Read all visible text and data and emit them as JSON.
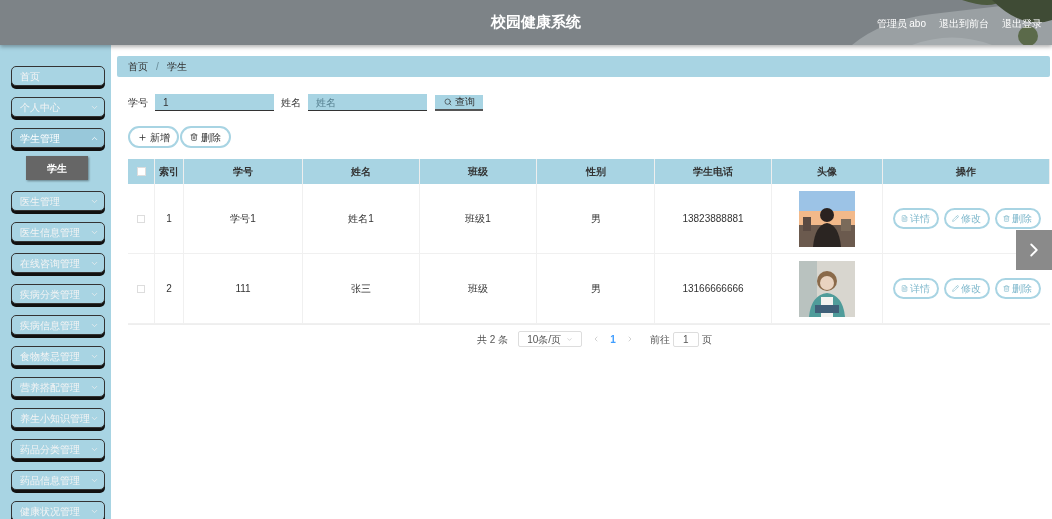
{
  "header": {
    "title": "校园健康系统",
    "links": [
      "管理员 abo",
      "退出到前台",
      "退出登录"
    ]
  },
  "sidebar": {
    "items": [
      {
        "label": "首页"
      },
      {
        "label": "个人中心",
        "expanded": false
      },
      {
        "label": "学生管理",
        "expanded": true,
        "children": [
          {
            "label": "学生",
            "selected": true
          }
        ]
      },
      {
        "label": "医生管理",
        "expanded": false
      },
      {
        "label": "医生信息管理",
        "expanded": false
      },
      {
        "label": "在线咨询管理",
        "expanded": false
      },
      {
        "label": "疾病分类管理",
        "expanded": false
      },
      {
        "label": "疾病信息管理",
        "expanded": false
      },
      {
        "label": "食物禁忌管理",
        "expanded": false
      },
      {
        "label": "营养搭配管理",
        "expanded": false
      },
      {
        "label": "养生小知识管理",
        "expanded": false
      },
      {
        "label": "药品分类管理",
        "expanded": false
      },
      {
        "label": "药品信息管理",
        "expanded": false
      },
      {
        "label": "健康状况管理",
        "expanded": false
      }
    ]
  },
  "breadcrumb": [
    "首页",
    "学生"
  ],
  "breadcrumb_separator": "/",
  "search": {
    "fields": [
      {
        "label": "学号",
        "value": "1"
      },
      {
        "label": "姓名",
        "placeholder": "姓名"
      }
    ],
    "button": "查询"
  },
  "actions": [
    {
      "kind": "add",
      "label": "新增"
    },
    {
      "kind": "delete",
      "label": "删除"
    }
  ],
  "table": {
    "all_checked": false,
    "columns": [
      "索引",
      "学号",
      "姓名",
      "班级",
      "性别",
      "学生电话",
      "头像",
      "操作"
    ],
    "rows": [
      {
        "checked": false,
        "index": "1",
        "student_no": "学号1",
        "name": "姓名1",
        "class": "班级1",
        "gender": "男",
        "phone": "13823888881",
        "buttons": [
          "详情",
          "修改",
          "删除"
        ]
      },
      {
        "checked": false,
        "index": "2",
        "student_no": "111",
        "name": "张三",
        "class": "班级",
        "gender": "男",
        "phone": "13166666666",
        "buttons": [
          "详情",
          "修改",
          "删除"
        ]
      }
    ]
  },
  "pagination": {
    "total": "共 2 条",
    "page_size": "10条/页",
    "pages": [
      {
        "label": "1",
        "selected": true
      }
    ],
    "goto_label": "前往",
    "goto_value": "1",
    "goto_suffix": "页"
  }
}
